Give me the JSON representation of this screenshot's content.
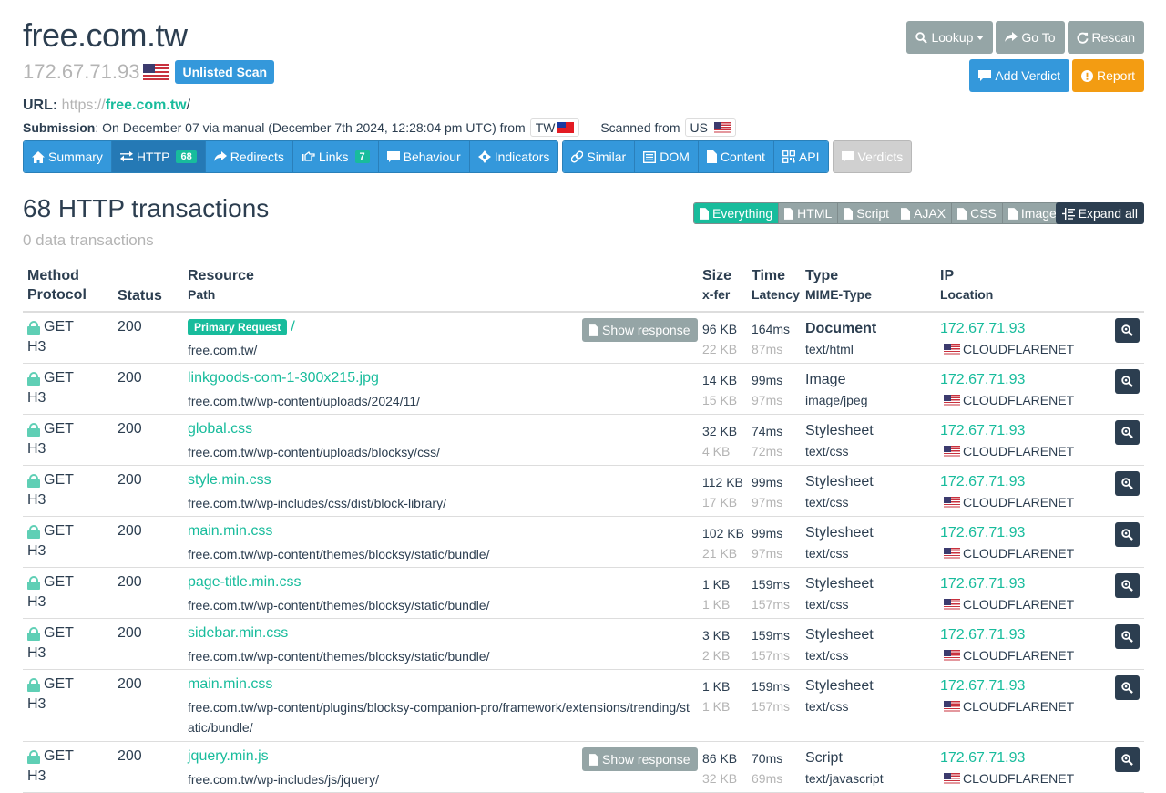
{
  "header": {
    "title": "free.com.tw",
    "ip": "172.67.71.93",
    "badge": "Unlisted Scan",
    "url_label": "URL:",
    "url_scheme": "https://",
    "url_host": "free.com.tw",
    "url_tail": "/",
    "submission_label": "Submission",
    "submission_text": ": On December 07 via manual (December 7th 2024, 12:28:04 pm UTC) from",
    "submission_country": "TW",
    "scanned_from_text": "— Scanned from",
    "scanned_country": "US"
  },
  "actions": {
    "lookup": "Lookup",
    "goto": "Go To",
    "rescan": "Rescan",
    "add_verdict": "Add Verdict",
    "report": "Report"
  },
  "nav": {
    "summary": "Summary",
    "http": "HTTP",
    "http_count": "68",
    "redirects": "Redirects",
    "links": "Links",
    "links_count": "7",
    "behaviour": "Behaviour",
    "indicators": "Indicators",
    "similar": "Similar",
    "dom": "DOM",
    "content": "Content",
    "api": "API",
    "verdicts": "Verdicts"
  },
  "section": {
    "title": "68 HTTP transactions",
    "subtitle": "0 data transactions",
    "filters": [
      "Everything",
      "HTML",
      "Script",
      "AJAX",
      "CSS",
      "Image"
    ],
    "active_filter": "Everything",
    "expand_all": "Expand all"
  },
  "table": {
    "headers": {
      "method": "Method",
      "protocol": "Protocol",
      "status": "Status",
      "resource": "Resource",
      "path": "Path",
      "size": "Size",
      "xfer": "x-fer",
      "time": "Time",
      "latency": "Latency",
      "type": "Type",
      "mime": "MIME-Type",
      "ip": "IP",
      "location": "Location"
    },
    "primary_badge": "Primary Request",
    "show_response": "Show response",
    "rows": [
      {
        "method": "GET",
        "protocol": "H3",
        "status": "200",
        "name": "/",
        "path": "free.com.tw/",
        "size": "96 KB",
        "xfer": "22 KB",
        "time": "164ms",
        "latency": "87ms",
        "type": "Document",
        "mime": "text/html",
        "ip": "172.67.71.93",
        "location": "CLOUDFLARENET"
      },
      {
        "method": "GET",
        "protocol": "H3",
        "status": "200",
        "name": "linkgoods-com-1-300x215.jpg",
        "path": "free.com.tw/wp-content/uploads/2024/11/",
        "size": "14 KB",
        "xfer": "15 KB",
        "time": "99ms",
        "latency": "97ms",
        "type": "Image",
        "mime": "image/jpeg",
        "ip": "172.67.71.93",
        "location": "CLOUDFLARENET"
      },
      {
        "method": "GET",
        "protocol": "H3",
        "status": "200",
        "name": "global.css",
        "path": "free.com.tw/wp-content/uploads/blocksy/css/",
        "size": "32 KB",
        "xfer": "4 KB",
        "time": "74ms",
        "latency": "72ms",
        "type": "Stylesheet",
        "mime": "text/css",
        "ip": "172.67.71.93",
        "location": "CLOUDFLARENET"
      },
      {
        "method": "GET",
        "protocol": "H3",
        "status": "200",
        "name": "style.min.css",
        "path": "free.com.tw/wp-includes/css/dist/block-library/",
        "size": "112 KB",
        "xfer": "17 KB",
        "time": "99ms",
        "latency": "97ms",
        "type": "Stylesheet",
        "mime": "text/css",
        "ip": "172.67.71.93",
        "location": "CLOUDFLARENET"
      },
      {
        "method": "GET",
        "protocol": "H3",
        "status": "200",
        "name": "main.min.css",
        "path": "free.com.tw/wp-content/themes/blocksy/static/bundle/",
        "size": "102 KB",
        "xfer": "21 KB",
        "time": "99ms",
        "latency": "97ms",
        "type": "Stylesheet",
        "mime": "text/css",
        "ip": "172.67.71.93",
        "location": "CLOUDFLARENET"
      },
      {
        "method": "GET",
        "protocol": "H3",
        "status": "200",
        "name": "page-title.min.css",
        "path": "free.com.tw/wp-content/themes/blocksy/static/bundle/",
        "size": "1 KB",
        "xfer": "1 KB",
        "time": "159ms",
        "latency": "157ms",
        "type": "Stylesheet",
        "mime": "text/css",
        "ip": "172.67.71.93",
        "location": "CLOUDFLARENET"
      },
      {
        "method": "GET",
        "protocol": "H3",
        "status": "200",
        "name": "sidebar.min.css",
        "path": "free.com.tw/wp-content/themes/blocksy/static/bundle/",
        "size": "3 KB",
        "xfer": "2 KB",
        "time": "159ms",
        "latency": "157ms",
        "type": "Stylesheet",
        "mime": "text/css",
        "ip": "172.67.71.93",
        "location": "CLOUDFLARENET"
      },
      {
        "method": "GET",
        "protocol": "H3",
        "status": "200",
        "name": "main.min.css",
        "path": "free.com.tw/wp-content/plugins/blocksy-companion-pro/framework/extensions/trending/static/bundle/",
        "size": "1 KB",
        "xfer": "1 KB",
        "time": "159ms",
        "latency": "157ms",
        "type": "Stylesheet",
        "mime": "text/css",
        "ip": "172.67.71.93",
        "location": "CLOUDFLARENET"
      },
      {
        "method": "GET",
        "protocol": "H3",
        "status": "200",
        "name": "jquery.min.js",
        "path": "free.com.tw/wp-includes/js/jquery/",
        "size": "86 KB",
        "xfer": "32 KB",
        "time": "70ms",
        "latency": "69ms",
        "type": "Script",
        "mime": "text/javascript",
        "ip": "172.67.71.93",
        "location": "CLOUDFLARENET"
      }
    ]
  }
}
